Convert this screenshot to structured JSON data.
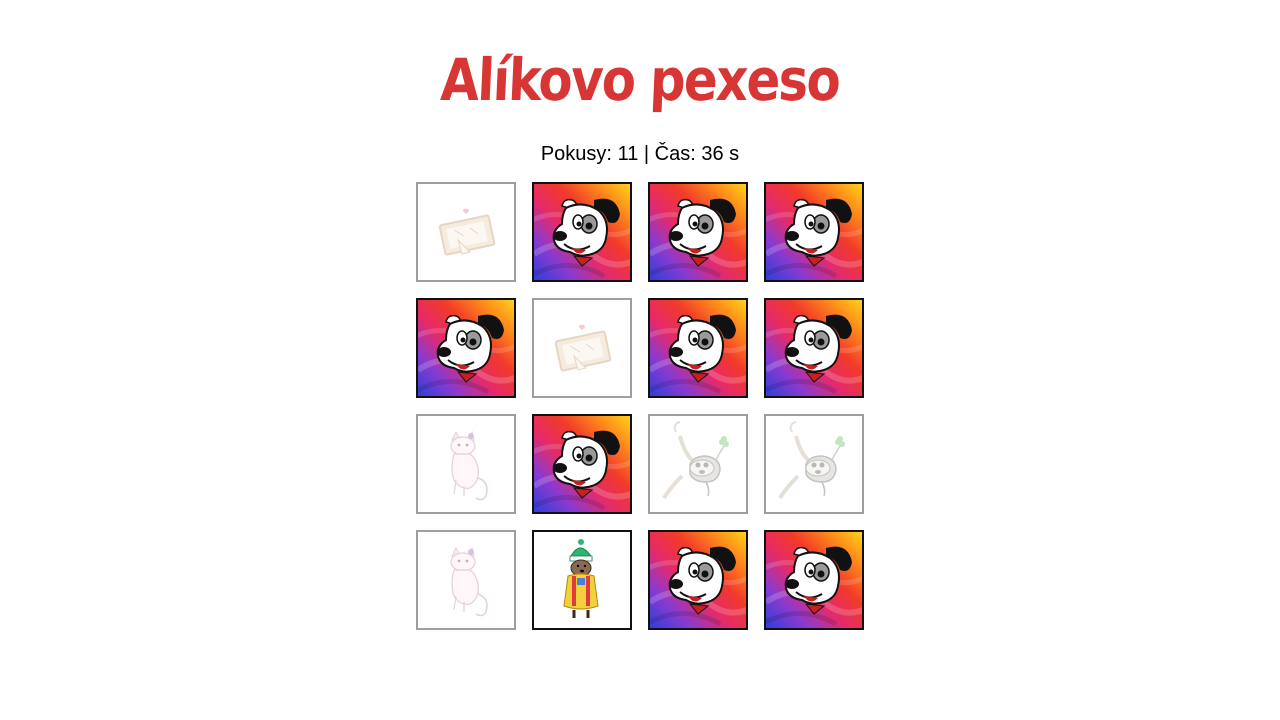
{
  "title": "Alíkovo pexeso",
  "status": {
    "attempts_label": "Pokusy:",
    "attempts": "11",
    "separator": "|",
    "time_label": "Čas:",
    "time": "36",
    "time_unit": "s"
  },
  "colors": {
    "title": "#d83535",
    "card_border": "#111111",
    "matched_border": "#9e9e9e"
  },
  "cards": [
    {
      "state": "matched",
      "image": "letter-icon"
    },
    {
      "state": "back",
      "image": "dog-card-back"
    },
    {
      "state": "back",
      "image": "dog-card-back"
    },
    {
      "state": "back",
      "image": "dog-card-back"
    },
    {
      "state": "back",
      "image": "dog-card-back"
    },
    {
      "state": "matched",
      "image": "letter-icon"
    },
    {
      "state": "back",
      "image": "dog-card-back"
    },
    {
      "state": "back",
      "image": "dog-card-back"
    },
    {
      "state": "matched",
      "image": "cat-icon"
    },
    {
      "state": "back",
      "image": "dog-card-back"
    },
    {
      "state": "matched",
      "image": "mouse-icon"
    },
    {
      "state": "matched",
      "image": "mouse-icon"
    },
    {
      "state": "matched",
      "image": "cat-icon"
    },
    {
      "state": "faceup",
      "image": "dwarf-icon"
    },
    {
      "state": "back",
      "image": "dog-card-back"
    },
    {
      "state": "back",
      "image": "dog-card-back"
    }
  ]
}
